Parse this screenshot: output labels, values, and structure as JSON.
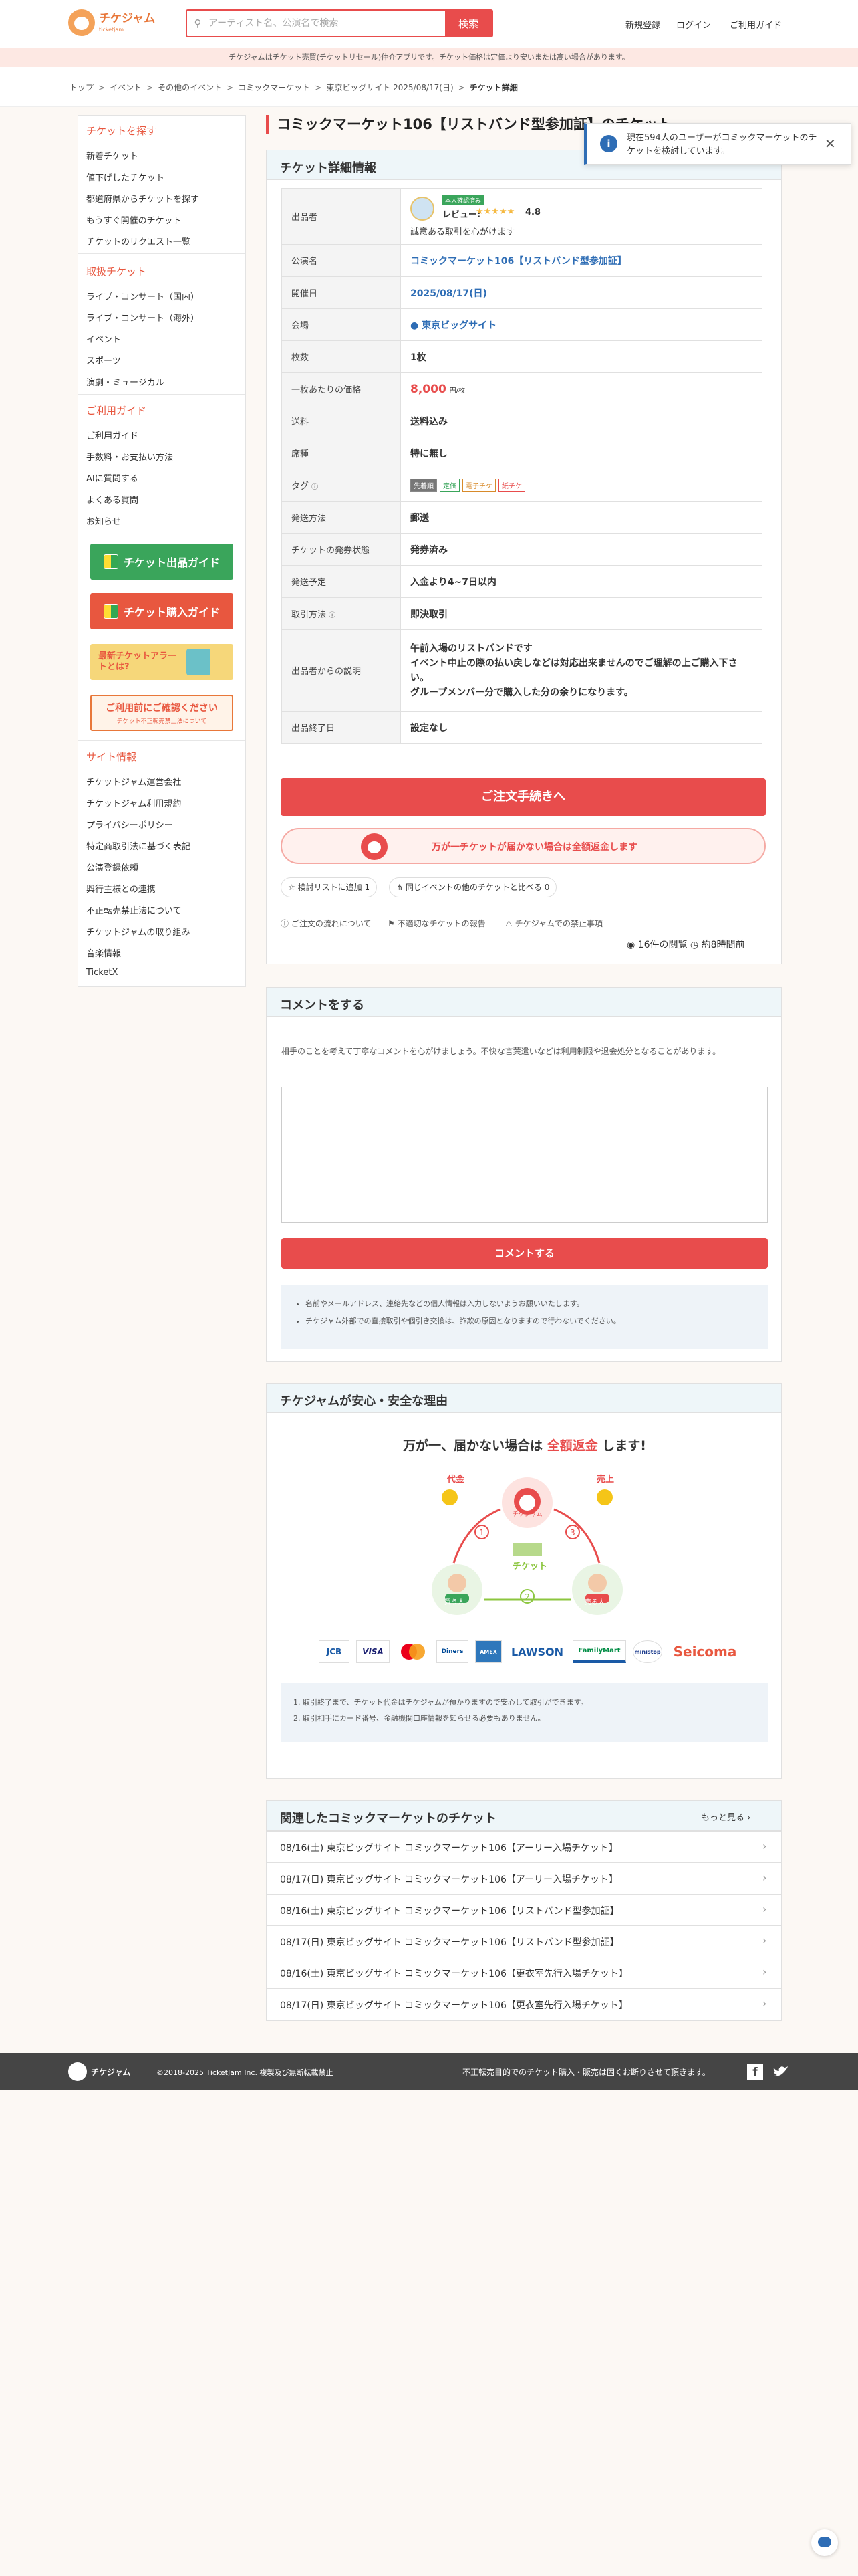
{
  "header": {
    "logo_text": "チケジャム",
    "logo_sub": "ticketjam",
    "search_placeholder": "アーティスト名、公演名で検索",
    "search_button": "検索",
    "nav": [
      "新規登録",
      "ログイン",
      "ご利用ガイド"
    ]
  },
  "notice": "チケジャムはチケット売買(チケットリセール)仲介アプリです。チケット価格は定価より安いまたは高い場合があります。",
  "breadcrumb": [
    "トップ",
    "イベント",
    "その他のイベント",
    "コミックマーケット",
    "東京ビッグサイト 2025/08/17(日)",
    "チケット詳細"
  ],
  "sidebar": {
    "find_head": "チケットを探す",
    "find_items": [
      "新着チケット",
      "値下げしたチケット",
      "都道府県からチケットを探す",
      "もうすぐ開催のチケット",
      "チケットのリクエスト一覧"
    ],
    "handle_head": "取扱チケット",
    "handle_items": [
      "ライブ・コンサート（国内）",
      "ライブ・コンサート（海外）",
      "イベント",
      "スポーツ",
      "演劇・ミュージカル"
    ],
    "guide_head": "ご利用ガイド",
    "guide_items": [
      "ご利用ガイド",
      "手数料・お支払い方法",
      "AIに質問する",
      "よくある質問",
      "お知らせ"
    ],
    "banners": [
      "チケット出品ガイド",
      "チケット購入ガイド",
      "最新チケットアラートとは?",
      "ご利用前にご確認ください"
    ],
    "banner_sub": "チケット不正転売禁止法について",
    "site_head": "サイト情報",
    "site_items": [
      "チケットジャム運営会社",
      "チケットジャム利用規約",
      "プライバシーポリシー",
      "特定商取引法に基づく表記",
      "公演登録依頼",
      "興行主様との連携",
      "不正転売禁止法について",
      "チケットジャムの取り組み",
      "音楽情報",
      "TicketX"
    ]
  },
  "title": "コミックマーケット106【リストバンド型参加証】のチケット",
  "toast": {
    "message": "現在594人のユーザーがコミックマーケットのチケットを検討しています。"
  },
  "detail": {
    "heading": "チケット詳細情報",
    "seller": {
      "badge": "本人確認済み",
      "review_label": "レビュー:",
      "stars": "★★★★★",
      "rating": "4.8",
      "comment": "誠意ある取引を心がけます"
    },
    "rows": [
      {
        "key": "公演名",
        "value": "コミックマーケット106【リストバンド型参加証】"
      },
      {
        "key": "開催日",
        "value": "2025/08/17(日)"
      },
      {
        "key": "会場",
        "value": "東京ビッグサイト"
      },
      {
        "key": "枚数",
        "value": "1枚"
      },
      {
        "key": "一枚あたりの価格",
        "value": "8,000",
        "unit": "円/枚"
      },
      {
        "key": "送料",
        "value": "送料込み"
      },
      {
        "key": "席種",
        "value": "特に無し"
      },
      {
        "key": "タグ",
        "value": ""
      },
      {
        "key": "発送方法",
        "value": "郵送"
      },
      {
        "key": "チケットの発券状態",
        "value": "発券済み"
      },
      {
        "key": "発送予定",
        "value": "入金より4~7日以内"
      },
      {
        "key": "取引方法",
        "value": "即決取引"
      },
      {
        "key": "出品者からの説明",
        "value": "午前入場のリストバンドです\nイベント中止の際の払い戻しなどは対応出来ませんのでご理解の上ご購入下さい。\nグループメンバー分で購入した分の余りになります。"
      },
      {
        "key": "出品終了日",
        "value": "設定なし"
      }
    ],
    "seller_key": "出品者",
    "tags": [
      "先着順",
      "定価",
      "電子チケ",
      "紙チケ"
    ],
    "order_button": "ご注文手続きへ",
    "guarantee": "万が一チケットが届かない場合は全額返金します",
    "fav_button": "検討リストに追加",
    "fav_count": "1",
    "compare_button": "同じイベントの他のチケットと比べる",
    "compare_count": "0",
    "links": [
      "ご注文の流れについて",
      "不適切なチケットの報告",
      "チケジャムでの禁止事項"
    ],
    "views": "16件の閲覧",
    "time": "約8時間前"
  },
  "comment": {
    "heading": "コメントをする",
    "description": "相手のことを考えて丁寧なコメントを心がけましょう。不快な言葉遣いなどは利用制限や退会処分となることがあります。",
    "button": "コメントする",
    "notes": [
      "名前やメールアドレス、連絡先などの個人情報は入力しないようお願いいたします。",
      "チケジャム外部での直接取引や個引き交換は、詐欺の原因となりますので行わないでください。"
    ]
  },
  "safety": {
    "heading": "チケジャムが安心・安全な理由",
    "lead_pre": "万が一、届かない場合は",
    "lead_em": "全額返金",
    "lead_post": "します!",
    "labels": {
      "money": "代金",
      "sales": "売上",
      "ticket": "チケット",
      "buyer": "買う人",
      "seller": "売る人",
      "center": "チケジャム"
    },
    "payment_logos": [
      "JCB",
      "VISA",
      "MC",
      "Diners",
      "AMEX",
      "LAWSON",
      "FamilyMart",
      "ministop",
      "Seicoma"
    ],
    "notes": [
      "取引終了まで、チケット代金はチケジャムが預かりますので安心して取引ができます。",
      "取引相手にカード番号、金融機関口座情報を知らせる必要もありません。"
    ]
  },
  "related": {
    "heading": "関連したコミックマーケットのチケット",
    "more": "もっと見る",
    "items": [
      "08/16(土) 東京ビッグサイト コミックマーケット106【アーリー入場チケット】",
      "08/17(日) 東京ビッグサイト コミックマーケット106【アーリー入場チケット】",
      "08/16(土) 東京ビッグサイト コミックマーケット106【リストバンド型参加証】",
      "08/17(日) 東京ビッグサイト コミックマーケット106【リストバンド型参加証】",
      "08/16(土) 東京ビッグサイト コミックマーケット106【更衣室先行入場チケット】",
      "08/17(日) 東京ビッグサイト コミックマーケット106【更衣室先行入場チケット】"
    ]
  },
  "footer": {
    "logo": "チケジャム",
    "copyright": "©2018-2025 TicketJam Inc. 複製及び無断転載禁止",
    "warning": "不正転売目的でのチケット購入・販売は固くお断りさせて頂きます。"
  },
  "colors": {
    "accent": "#e84c4c",
    "link": "#2e6db5",
    "panel_head": "#eef6f9"
  }
}
